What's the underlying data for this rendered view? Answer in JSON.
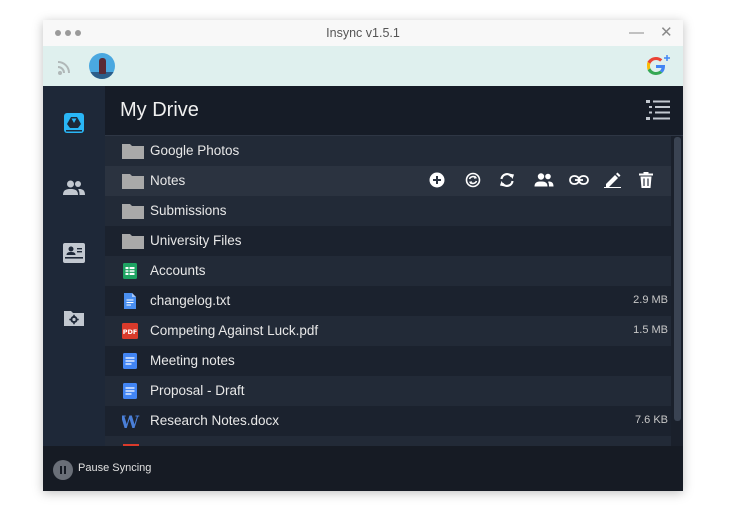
{
  "window": {
    "title": "Insync v1.5.1",
    "minimize_glyph": "—",
    "close_glyph": "✕"
  },
  "toolbar": {
    "icons": [
      "signal-icon",
      "user-avatar",
      "google-account-icon"
    ]
  },
  "sidebar": {
    "items": [
      "my-drive-icon",
      "shared-with-me-icon",
      "computers-icon",
      "folder-settings-icon"
    ]
  },
  "main": {
    "title": "My Drive",
    "view_icon": "list-view-icon",
    "files": [
      {
        "name": "Google Photos",
        "type": "folder",
        "size": ""
      },
      {
        "name": "Notes",
        "type": "folder",
        "size": ""
      },
      {
        "name": "Submissions",
        "type": "folder",
        "size": ""
      },
      {
        "name": "University Files",
        "type": "folder",
        "size": ""
      },
      {
        "name": "Accounts",
        "type": "sheet",
        "size": ""
      },
      {
        "name": "changelog.txt",
        "type": "txt",
        "size": "2.9 MB"
      },
      {
        "name": "Competing Against Luck.pdf",
        "type": "pdf",
        "size": "1.5 MB"
      },
      {
        "name": "Meeting notes",
        "type": "doc",
        "size": ""
      },
      {
        "name": "Proposal - Draft",
        "type": "doc",
        "size": ""
      },
      {
        "name": "Research Notes.docx",
        "type": "word",
        "size": "7.6 KB"
      }
    ],
    "row_actions": [
      "add-icon",
      "sync-options-icon",
      "refresh-icon",
      "share-icon",
      "link-icon",
      "rename-icon",
      "delete-icon"
    ]
  },
  "footer": {
    "pause_label": "Pause Syncing"
  },
  "colors": {
    "accent": "#29b6f6",
    "window_bg": "#1c2330",
    "toolbar_bg": "#dff0ee",
    "folder": "#a9a9a9"
  }
}
